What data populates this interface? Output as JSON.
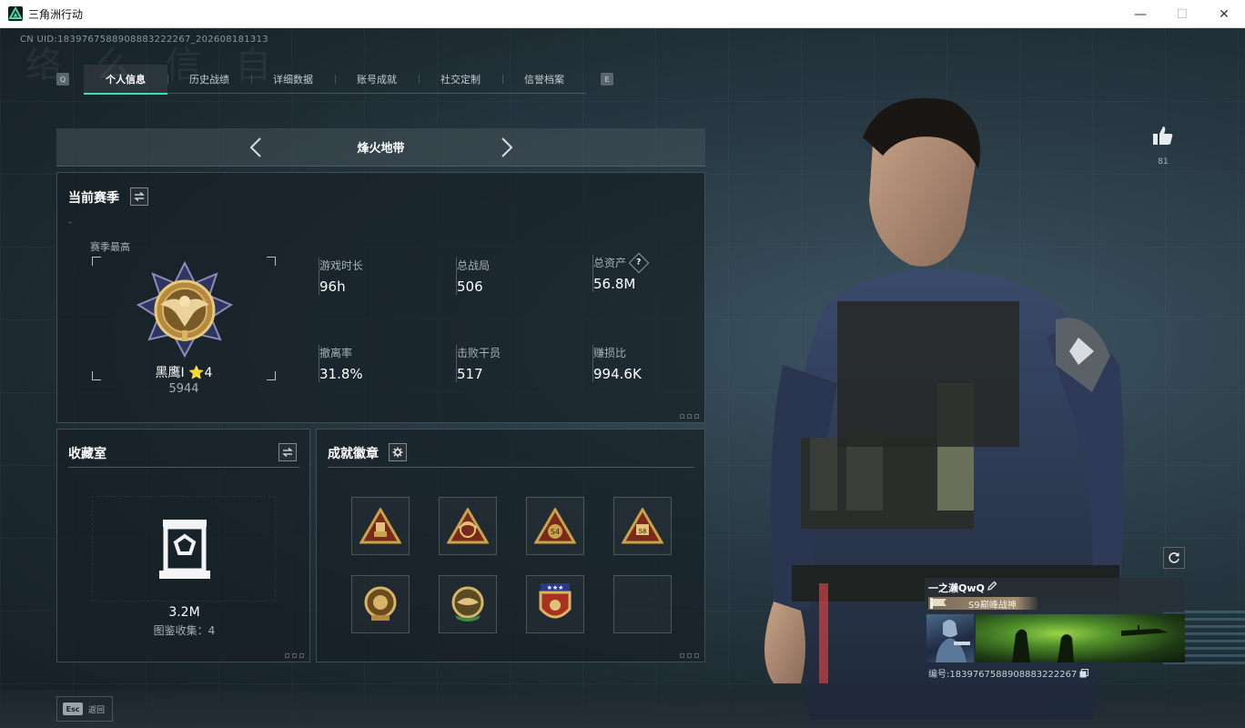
{
  "window": {
    "title": "三角洲行动",
    "minimize": "—",
    "maximize": "☐",
    "close": "✕"
  },
  "header": {
    "uid": "CN UID:1839767588908883222267_202608181313",
    "bg_text": "络 么 信 自",
    "left_key": "Q",
    "right_key": "E"
  },
  "tabs": [
    {
      "label": "个人信息",
      "active": true
    },
    {
      "label": "历史战绩",
      "active": false
    },
    {
      "label": "详细数据",
      "active": false
    },
    {
      "label": "账号成就",
      "active": false
    },
    {
      "label": "社交定制",
      "active": false
    },
    {
      "label": "信誉档案",
      "active": false
    }
  ],
  "mode_selector": {
    "title": "烽火地带"
  },
  "season": {
    "title": "当前赛季",
    "rank_label": "赛季最高",
    "rank_name": "黑鹰I ⭐4",
    "rank_points": "5944",
    "stats": [
      {
        "label": "游戏时长",
        "value": "96h"
      },
      {
        "label": "总战局",
        "value": "506"
      },
      {
        "label": "总资产",
        "value": "56.8M",
        "help": "?"
      },
      {
        "label": "撤离率",
        "value": "31.8%"
      },
      {
        "label": "击败干员",
        "value": "517"
      },
      {
        "label": "赚损比",
        "value": "994.6K"
      }
    ]
  },
  "collection": {
    "title": "收藏室",
    "value": "3.2M",
    "count_text": "图鉴收集：4"
  },
  "badges": {
    "title": "成就徽章",
    "slots": [
      {
        "icon": "bullet-badge-icon",
        "empty": false
      },
      {
        "icon": "eagle-badge-icon",
        "empty": false
      },
      {
        "icon": "s4-badge-icon",
        "empty": false
      },
      {
        "icon": "s8-badge-icon",
        "empty": false
      },
      {
        "icon": "round-gold-badge-icon",
        "empty": false
      },
      {
        "icon": "green-ribbon-badge-icon",
        "empty": false
      },
      {
        "icon": "star-shield-badge-icon",
        "empty": false
      },
      {
        "icon": "empty-slot",
        "empty": true
      }
    ]
  },
  "likes": {
    "count": "81"
  },
  "player_card": {
    "name": "一之濑QwQ",
    "title_tag": "S9巅峰战神",
    "id_text": "编号:1839767588908883222267"
  },
  "footer": {
    "esc_key": "Esc",
    "back_label": "返回"
  },
  "colors": {
    "accent": "#3fe0a8",
    "panel_bg": "#16202699",
    "gold": "#c9a24a"
  }
}
